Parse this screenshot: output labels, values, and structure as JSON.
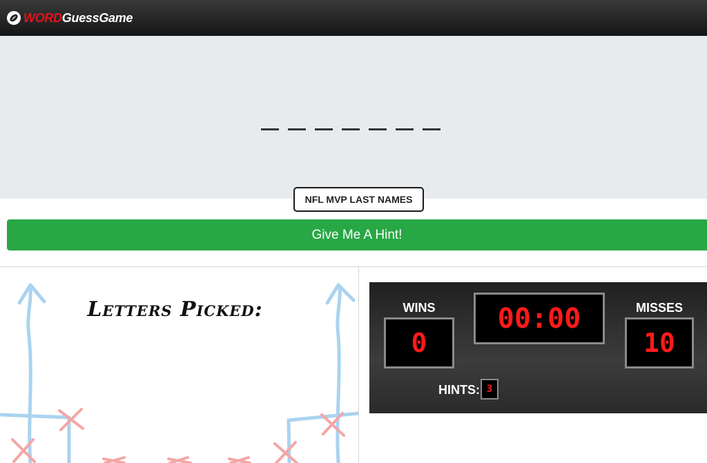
{
  "header": {
    "logo_word": "WORD",
    "logo_rest": "GuessGame",
    "logo_icon": "football-icon"
  },
  "game": {
    "blanks_count": 7,
    "category": "NFL MVP LAST NAMES",
    "hint_button": "Give Me A Hint!",
    "letters_title": "Letters Picked:",
    "letters_picked": ""
  },
  "scoreboard": {
    "wins_label": "WINS",
    "wins": "0",
    "timer": "00:00",
    "misses_label": "MISSES",
    "misses": "10",
    "hints_label": "HINTS:",
    "hints": "3"
  },
  "colors": {
    "hint_green": "#28a745",
    "score_red": "#ff1a1a",
    "logo_red": "#e0141b",
    "play_blue": "#aad3ef",
    "play_pink": "#f4a6a6"
  }
}
